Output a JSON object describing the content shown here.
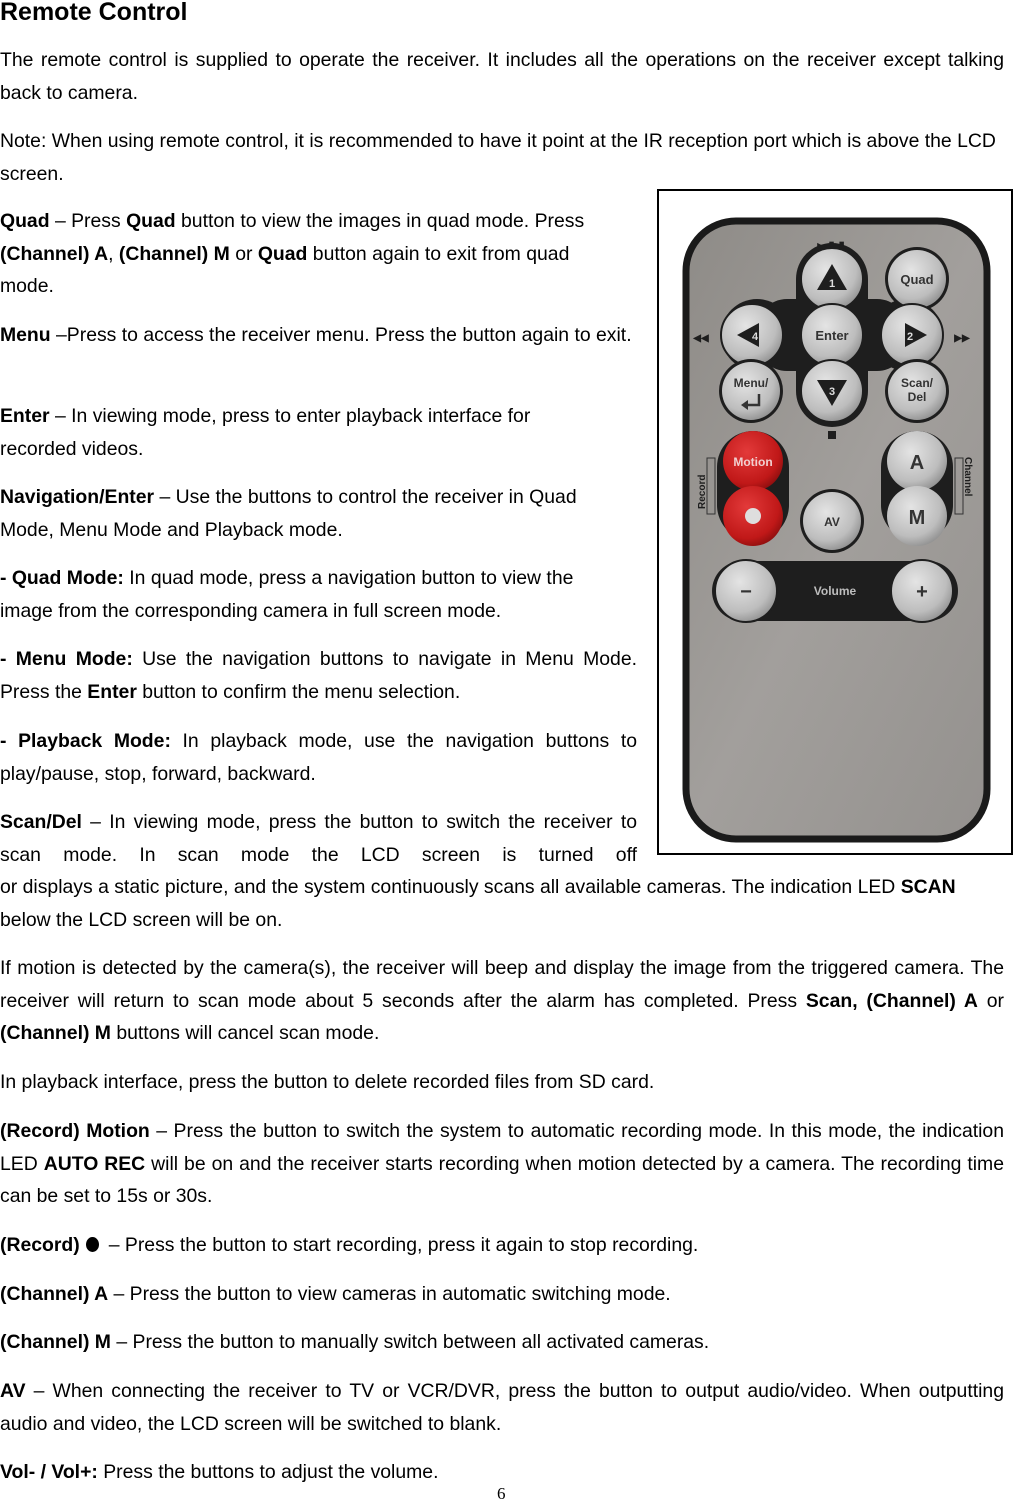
{
  "title": "Remote Control",
  "intro": "The remote control is supplied to operate the receiver. It includes all the operations on the receiver except talking back to camera.",
  "note": "Note: When using remote control, it is recommended to have it point at the IR reception port which is above the LCD screen.",
  "sections": {
    "quad": {
      "t1": "Quad",
      "s1": " – Press ",
      "t2": "Quad",
      "s2": " button to view the images in quad mode. Press ",
      "t3": "(Channel) A",
      "s3": ", ",
      "t4": "(Channel) M",
      "s4": " or ",
      "t5": "Quad",
      "s5": " button again to exit from quad mode."
    },
    "menu": {
      "t1": "Menu",
      "s1": " –Press to access the receiver menu. Press the button again to exit."
    },
    "enter": {
      "t1": "Enter",
      "s1": " – In viewing mode, press to enter playback interface for recorded videos."
    },
    "navigation": {
      "t1": "Navigation/Enter",
      "s1": " – Use the buttons to control the receiver in Quad Mode, Menu Mode and Playback mode."
    },
    "quad_mode": {
      "t1": "- Quad Mode:",
      "s1": " In quad mode, press a navigation button to view the image from the corresponding camera in full screen mode."
    },
    "menu_mode": {
      "t1": "- Menu Mode:",
      "s1": " Use the navigation buttons to navigate in Menu Mode. Press the ",
      "t2": "Enter",
      "s2": " button to confirm the menu selection."
    },
    "playback_mode": {
      "t1": "- Playback Mode:",
      "s1": " In playback mode, use the navigation buttons to play/pause, stop, forward, backward."
    },
    "scan": {
      "t1": "Scan/Del",
      "s1": " – In viewing mode, press the button to switch the receiver to scan mode. In scan mode the LCD screen is turned off",
      "s2": "or displays a static picture, and the system continuously scans all available cameras. The indication LED ",
      "t2": "SCAN",
      "s3": " below the LCD screen will be on."
    },
    "motion_detect": {
      "s1": "If motion is detected by the camera(s), the receiver will beep and display the image from the triggered camera. The receiver will return to scan mode about 5 seconds after the alarm has completed. Press ",
      "t1": "Scan, (Channel) A",
      "s2": " or ",
      "t2": "(Channel) M",
      "s3": " buttons will cancel scan mode."
    },
    "playback_delete": "In playback interface, press the button to delete recorded files from SD card.",
    "record_motion": {
      "t1": "(Record) Motion",
      "s1": " – Press the button to switch the system to automatic recording mode. In this mode, the indication LED ",
      "t2": "AUTO REC",
      "s2": " will be on and the receiver starts recording when motion detected by a camera. The recording time can be set to 15s or 30s."
    },
    "record": {
      "t1": "(Record)",
      "s1": "– Press the button to start recording, press it again to stop recording."
    },
    "channel_a": {
      "t1": "(Channel) A",
      "s1": " – Press the button to view cameras in automatic switching mode."
    },
    "channel_m": {
      "t1": "(Channel) M",
      "s1": " – Press the button to manually switch between all activated cameras."
    },
    "av": {
      "t1": "AV",
      "s1": " – When connecting the receiver to TV or VCR/DVR, press the button to output audio/video. When outputting audio and video, the LCD screen will be switched to blank."
    },
    "volume": {
      "t1": "Vol- / Vol+:",
      "s1": " Press the buttons to adjust the volume."
    }
  },
  "remote": {
    "buttons": {
      "up": "1",
      "right": "2",
      "down": "3",
      "left": "4",
      "enter": "Enter",
      "quad": "Quad",
      "menu_line1": "Menu/",
      "scan_line1": "Scan/",
      "scan_line2": "Del",
      "motion": "Motion",
      "av": "AV",
      "channel_a": "A",
      "channel_m": "M",
      "vol_minus": "−",
      "vol_plus": "+",
      "volume_label": "Volume"
    },
    "side_labels": {
      "record": "Record",
      "channel": "Channel"
    },
    "colors": {
      "body": "#9c9a97",
      "button": "#c4c4c4",
      "dark": "#1e1e1e",
      "red": "#c81e1e"
    }
  },
  "page_number": "6"
}
